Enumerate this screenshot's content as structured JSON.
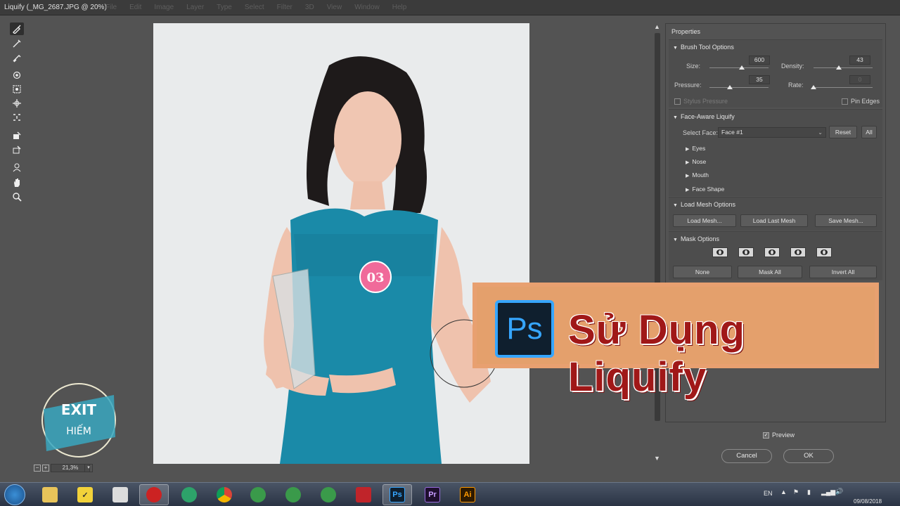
{
  "window": {
    "title": "Liquify (_MG_2687.JPG @ 20%)"
  },
  "ghost_menu": [
    "File",
    "Edit",
    "Image",
    "Layer",
    "Type",
    "Select",
    "Filter",
    "3D",
    "View",
    "Window",
    "Help"
  ],
  "tools": [
    "forward-warp-icon",
    "reconstruct-icon",
    "smooth-icon",
    "twirl-icon",
    "pucker-icon",
    "bloat-icon",
    "push-left-icon",
    "freeze-mask-icon",
    "thaw-mask-icon",
    "face-tool-icon",
    "hand-icon",
    "zoom-icon"
  ],
  "zoom": {
    "value": "21,3%"
  },
  "properties": {
    "title": "Properties",
    "brush": {
      "heading": "Brush Tool Options",
      "size_label": "Size:",
      "size_value": "600",
      "size_level": 0.55,
      "density_label": "Density:",
      "density_value": "43",
      "density_level": 0.43,
      "pressure_label": "Pressure:",
      "pressure_value": "35",
      "pressure_level": 0.35,
      "rate_label": "Rate:",
      "rate_value": "0",
      "rate_level": 0.0,
      "stylus_label": "Stylus Pressure",
      "pin_edges_label": "Pin Edges"
    },
    "face": {
      "heading": "Face-Aware Liquify",
      "select_label": "Select Face:",
      "select_value": "Face #1",
      "reset_label": "Reset",
      "all_label": "All",
      "items": [
        "Eyes",
        "Nose",
        "Mouth",
        "Face Shape"
      ]
    },
    "mesh": {
      "heading": "Load Mesh Options",
      "load_label": "Load Mesh...",
      "load_last_label": "Load Last Mesh",
      "save_label": "Save Mesh..."
    },
    "mask": {
      "heading": "Mask Options",
      "none_label": "None",
      "mask_all_label": "Mask All",
      "invert_all_label": "Invert All"
    }
  },
  "footer": {
    "preview_label": "Preview",
    "cancel_label": "Cancel",
    "ok_label": "OK"
  },
  "banner": {
    "logo_text": "Ps",
    "title": "Sử Dụng Liquify"
  },
  "watermark": {
    "line1": "EXIT",
    "line2": "HIẾM"
  },
  "photo": {
    "badge_number": "03"
  },
  "taskbar": {
    "apps": [
      "file-explorer-icon",
      "sticky-notes-icon",
      "calculator-icon",
      "screen-recorder-icon",
      "app-green-icon",
      "chrome-icon",
      "app-coc-coc-1-icon",
      "app-coc-coc-2-icon",
      "app-coc-coc-3-icon",
      "app-red-icon",
      "photoshop-icon",
      "premiere-icon",
      "illustrator-icon"
    ],
    "ps_label": "Ps",
    "pr_label": "Pr",
    "ai_label": "Ai",
    "lang": "EN",
    "date": "09/08/2018"
  },
  "colors": {
    "accent": "#36a6ff",
    "banner_bg": "#e4a06c",
    "banner_text": "#a01818"
  }
}
